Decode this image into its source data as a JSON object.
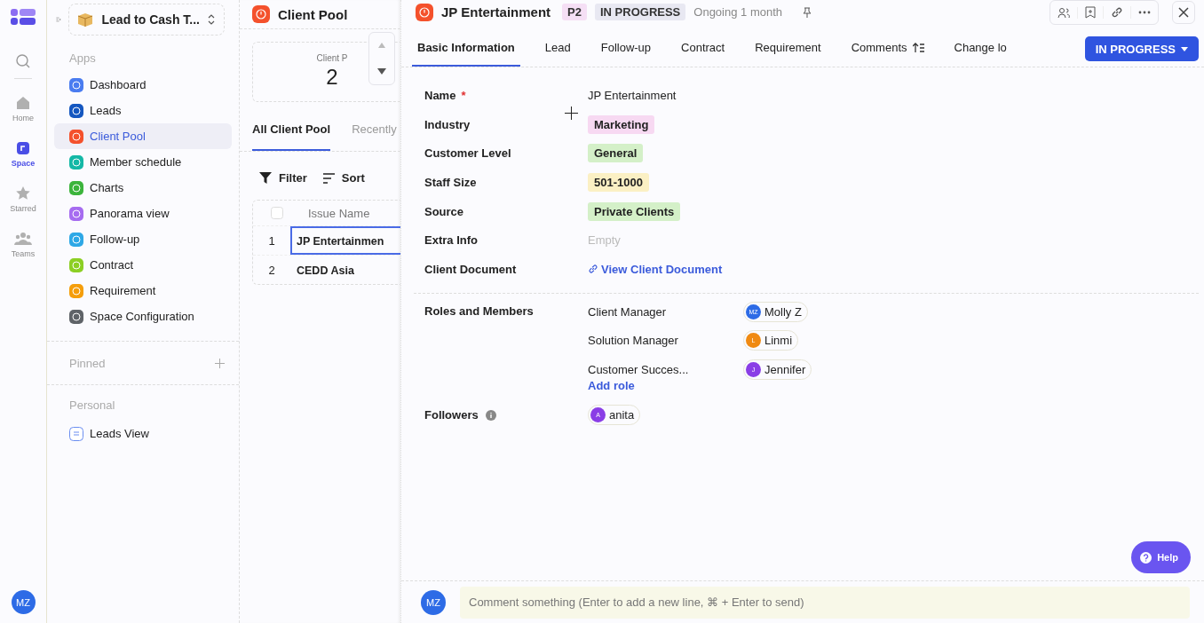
{
  "rail": {
    "items": [
      {
        "label": "Home",
        "selected": false
      },
      {
        "label": "Space",
        "selected": true
      },
      {
        "label": "Starred",
        "selected": false
      },
      {
        "label": "Teams",
        "selected": false
      }
    ],
    "user_avatar": "MZ"
  },
  "sidebar": {
    "workspace": "Lead to Cash T...",
    "apps_heading": "Apps",
    "apps": [
      {
        "label": "Dashboard",
        "color": "#4a7cf0",
        "selected": false
      },
      {
        "label": "Leads",
        "color": "#1557c0",
        "selected": false
      },
      {
        "label": "Client Pool",
        "color": "#f4512c",
        "selected": true
      },
      {
        "label": "Member schedule",
        "color": "#14b8a6",
        "selected": false
      },
      {
        "label": "Charts",
        "color": "#3cb43c",
        "selected": false
      },
      {
        "label": "Panorama view",
        "color": "#a66cf0",
        "selected": false
      },
      {
        "label": "Follow-up",
        "color": "#2ea8e6",
        "selected": false
      },
      {
        "label": "Contract",
        "color": "#8ccf24",
        "selected": false
      },
      {
        "label": "Requirement",
        "color": "#f59e0b",
        "selected": false
      },
      {
        "label": "Space Configuration",
        "color": "#5f6368",
        "selected": false
      }
    ],
    "pinned_heading": "Pinned",
    "personal_heading": "Personal",
    "personal": [
      {
        "label": "Leads View"
      }
    ]
  },
  "list_panel": {
    "title": "Client Pool",
    "stat": {
      "label": "Client P",
      "value": "2"
    },
    "tabs": [
      {
        "label": "All Client Pool",
        "selected": true
      },
      {
        "label": "Recently",
        "selected": false
      }
    ],
    "toolbar": [
      "Filter",
      "Sort"
    ],
    "table": {
      "select_all_checked": false,
      "columns": [
        "Issue Name"
      ],
      "rows": [
        {
          "index": "1",
          "name": "JP Entertainmen",
          "selected": true
        },
        {
          "index": "2",
          "name": "CEDD Asia",
          "selected": false
        }
      ]
    }
  },
  "detail": {
    "title": "JP Entertainment",
    "priority": "P2",
    "status": "IN PROGRESS",
    "duration": "Ongoing 1 month",
    "tabs": [
      {
        "label": "Basic Information",
        "selected": true
      },
      {
        "label": "Lead",
        "selected": false
      },
      {
        "label": "Follow-up",
        "selected": false
      },
      {
        "label": "Contract",
        "selected": false
      },
      {
        "label": "Requirement",
        "selected": false
      },
      {
        "label": "Comments",
        "selected": false
      },
      {
        "label": "Change lo",
        "selected": false
      }
    ],
    "status_button": "IN PROGRESS",
    "fields": [
      {
        "label": "Name",
        "required_mark": "*",
        "kind": "text",
        "value": "JP Entertainment"
      },
      {
        "label": "Industry",
        "kind": "tag",
        "value": "Marketing",
        "color": "#f7d9f2"
      },
      {
        "label": "Customer Level",
        "kind": "tag",
        "value": "General",
        "color": "#d4f0c8"
      },
      {
        "label": "Staff Size",
        "kind": "tag",
        "value": "501-1000",
        "color": "#fbf0c4"
      },
      {
        "label": "Source",
        "kind": "tag",
        "value": "Private Clients",
        "color": "#d4f0c8"
      },
      {
        "label": "Extra Info",
        "kind": "empty",
        "placeholder": "Empty"
      },
      {
        "label": "Client Document",
        "kind": "link",
        "value": "View Client Document"
      }
    ],
    "roles_label": "Roles and Members",
    "roles": [
      {
        "role": "Client Manager",
        "member": "Molly Z",
        "initials": "MZ",
        "color": "#2d6be6"
      },
      {
        "role": "Solution Manager",
        "member": "Linmi",
        "initials": "L",
        "color": "#f08a12"
      },
      {
        "role": "Customer Succes...",
        "member": "Jennifer",
        "initials": "J",
        "color": "#8a3ee6"
      }
    ],
    "add_role": "Add role",
    "followers_label": "Followers",
    "followers": [
      {
        "member": "anita",
        "initials": "A",
        "color": "#8a3ee6"
      }
    ],
    "comment": {
      "avatar": "MZ",
      "placeholder": "Comment something (Enter to add a new line, ⌘ + Enter to send)"
    },
    "help": "Help"
  }
}
